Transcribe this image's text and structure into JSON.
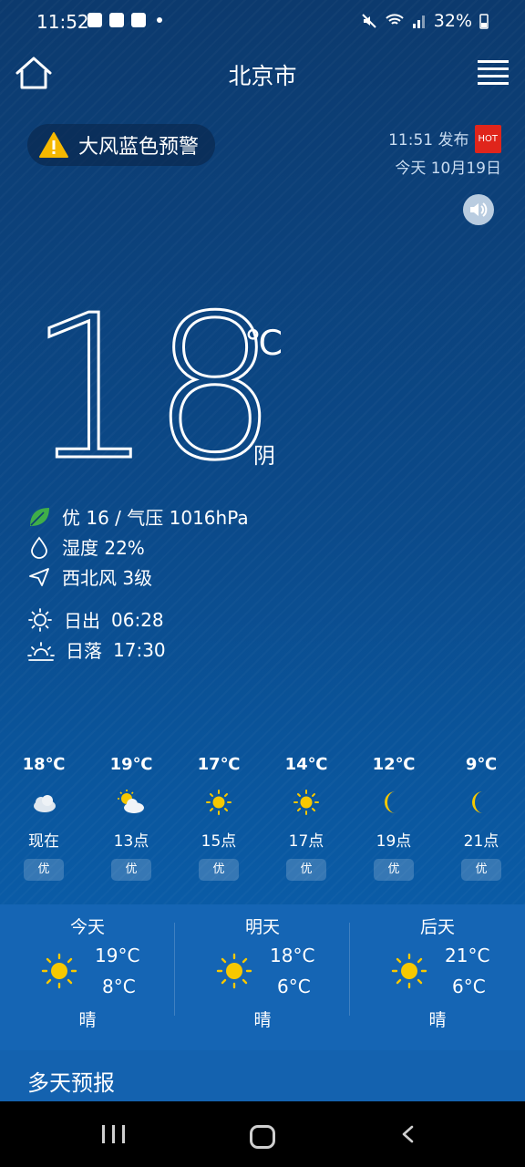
{
  "status_bar": {
    "time": "11:52",
    "battery": "32%"
  },
  "header": {
    "city": "北京市"
  },
  "alert": {
    "text": "大风蓝色预警",
    "publish_time": "11:51 发布",
    "hot_badge": "HOT",
    "date": "今天 10月19日"
  },
  "current": {
    "temperature": "18",
    "unit": "℃",
    "condition": "阴",
    "aqi_pressure": "优 16 / 气压 1016hPa",
    "humidity": "湿度 22%",
    "wind": "西北风 3级",
    "sunrise_label": "日出",
    "sunrise_time": "06:28",
    "sunset_label": "日落",
    "sunset_time": "17:30"
  },
  "hourly": [
    {
      "temp": "18℃",
      "hour": "现在",
      "quality": "优",
      "icon": "cloudy-icon"
    },
    {
      "temp": "19℃",
      "hour": "13点",
      "quality": "优",
      "icon": "partly-cloudy-icon"
    },
    {
      "temp": "17℃",
      "hour": "15点",
      "quality": "优",
      "icon": "sun-icon"
    },
    {
      "temp": "14℃",
      "hour": "17点",
      "quality": "优",
      "icon": "sun-icon"
    },
    {
      "temp": "12℃",
      "hour": "19点",
      "quality": "优",
      "icon": "moon-icon"
    },
    {
      "temp": "9℃",
      "hour": "21点",
      "quality": "优",
      "icon": "moon-icon"
    }
  ],
  "days": [
    {
      "name": "今天",
      "high": "19°C",
      "low": "8°C",
      "desc": "晴",
      "icon": "sun-icon"
    },
    {
      "name": "明天",
      "high": "18°C",
      "low": "6°C",
      "desc": "晴",
      "icon": "sun-icon"
    },
    {
      "name": "后天",
      "high": "21°C",
      "low": "6°C",
      "desc": "晴",
      "icon": "sun-icon"
    }
  ],
  "multi_day": {
    "title": "多天预报"
  },
  "colors": {
    "accent_sun": "#f7c800",
    "hot_red": "#e0251b",
    "aqi_green": "#3fae49"
  }
}
